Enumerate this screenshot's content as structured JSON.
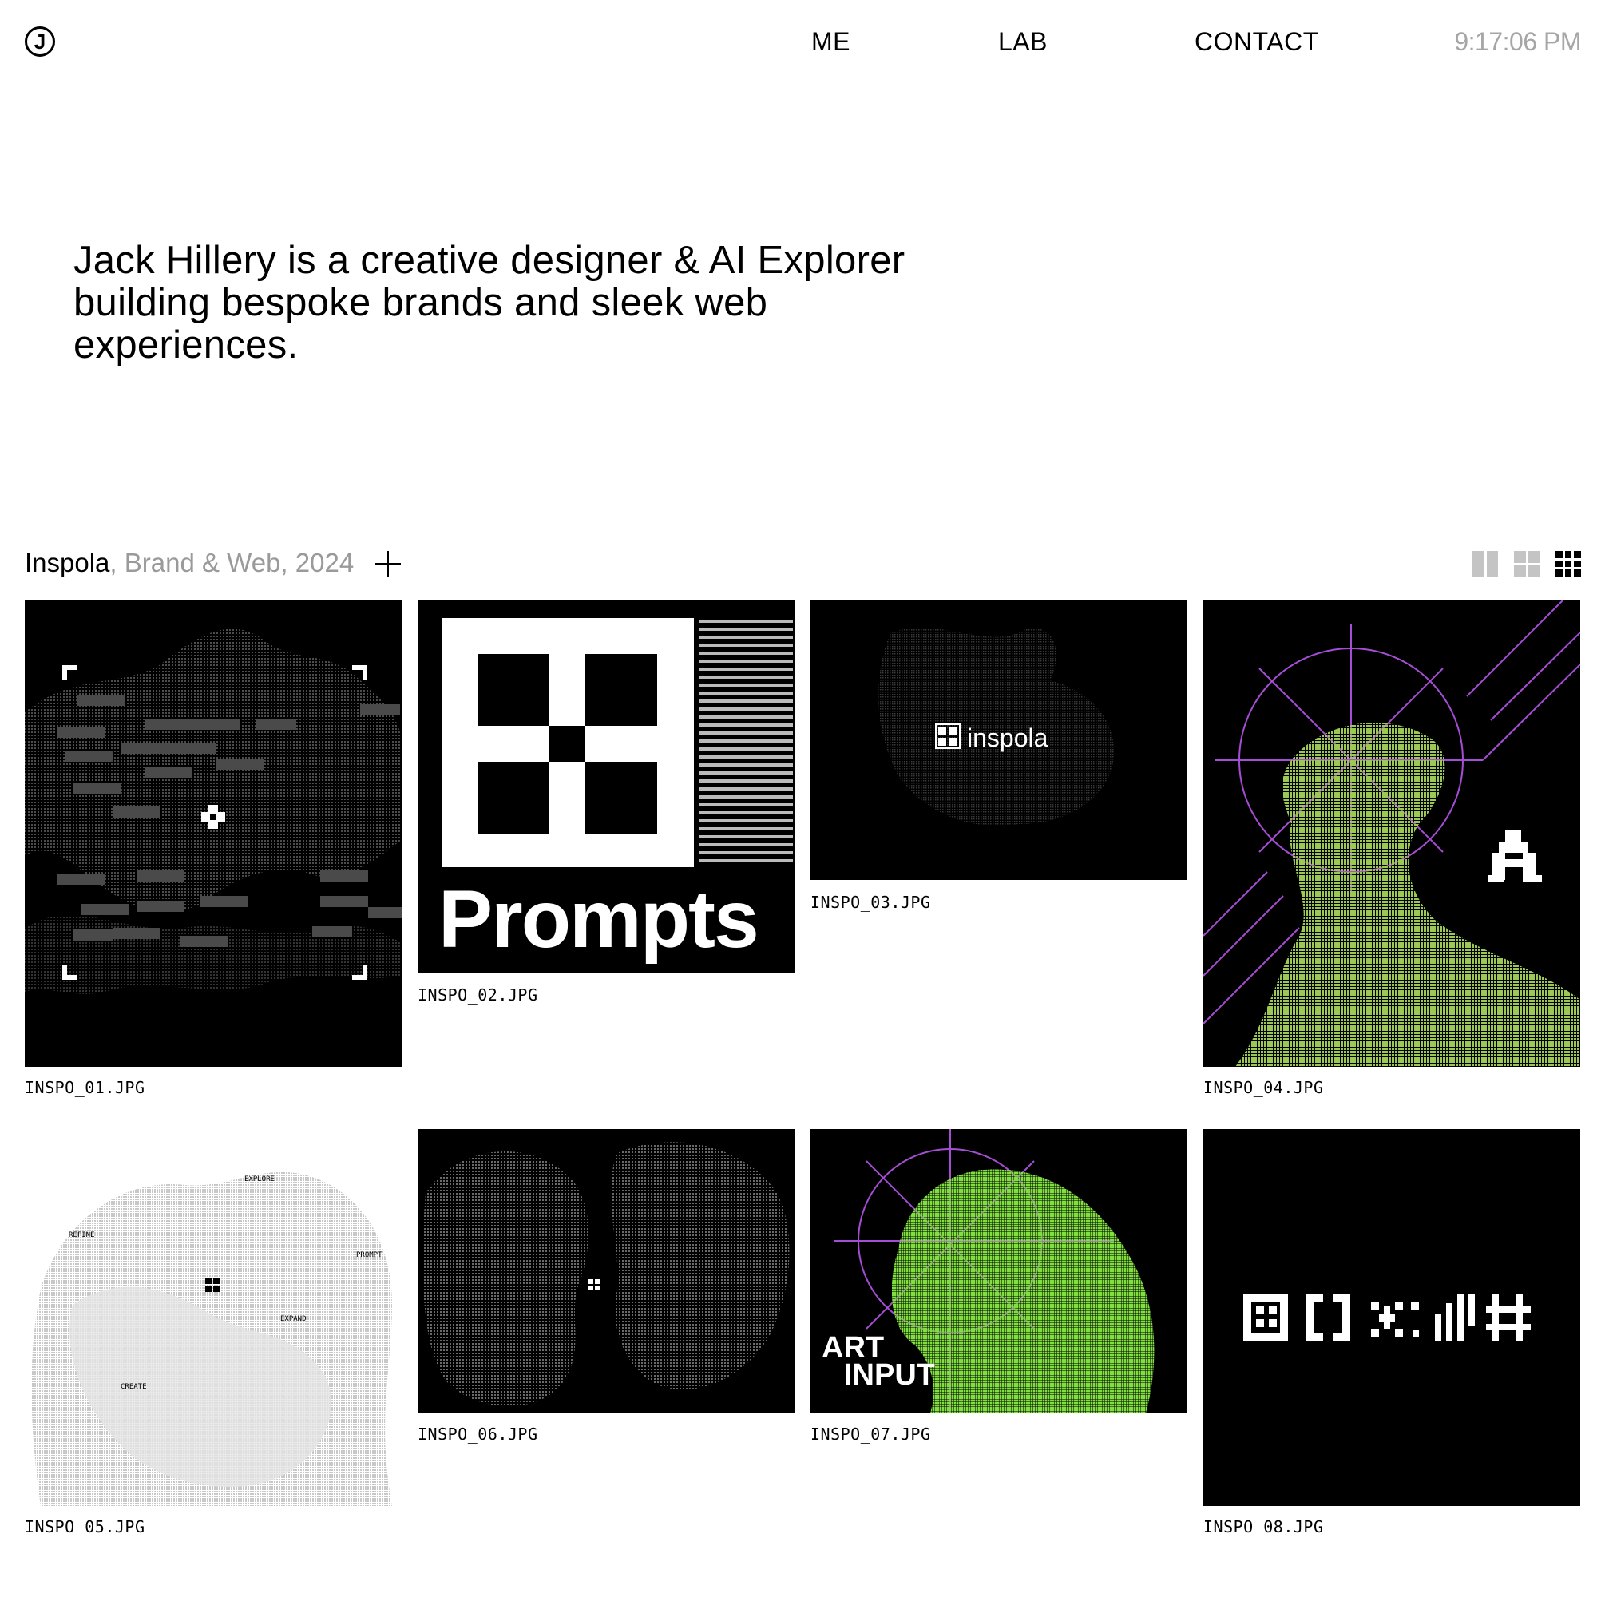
{
  "header": {
    "logo_letter": "J",
    "nav": [
      "ME",
      "LAB",
      "CONTACT"
    ],
    "clock": "9:17:06 PM"
  },
  "hero": {
    "text": "Jack Hillery is a creative designer & AI Explorer building bespoke brands and sleek web experiences."
  },
  "project": {
    "name": "Inspola",
    "meta": ", Brand & Web, 2024"
  },
  "gallery": [
    {
      "caption": "INSPO_01.JPG"
    },
    {
      "caption": "INSPO_02.JPG",
      "text": "Prompts"
    },
    {
      "caption": "INSPO_03.JPG",
      "text": "inspola"
    },
    {
      "caption": "INSPO_04.JPG",
      "accent": "#b5e257"
    },
    {
      "caption": "INSPO_05.JPG",
      "labels": [
        "EXPLORE",
        "REFINE",
        "PROMPT",
        "EXPAND",
        "CREATE"
      ]
    },
    {
      "caption": "INSPO_06.JPG"
    },
    {
      "caption": "INSPO_07.JPG",
      "text_line1": "ART",
      "text_line2": "INPUT",
      "accent": "#7fe040"
    },
    {
      "caption": "INSPO_08.JPG"
    }
  ],
  "colors": {
    "purple": "#a64dd6",
    "green": "#8fcf3e",
    "muted": "#9a9a9a"
  }
}
